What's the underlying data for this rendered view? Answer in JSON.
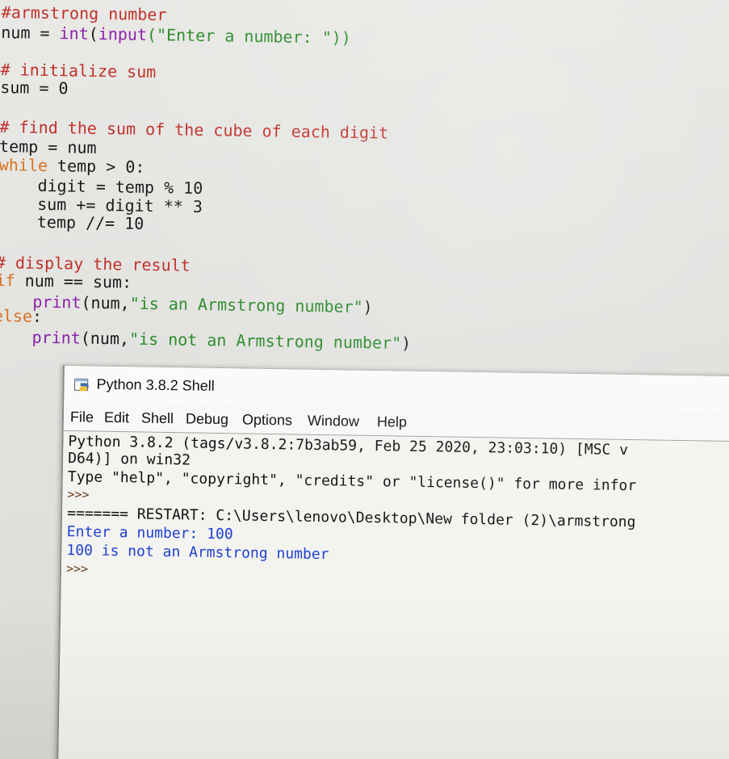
{
  "editor": {
    "lines": [
      {
        "text": "#armstrong number",
        "kind": "comment"
      },
      {
        "parts": [
          "num = ",
          "int",
          "(",
          "input",
          "(\"Enter a number: \"))"
        ]
      },
      {
        "text": "# initialize sum",
        "kind": "comment"
      },
      {
        "text": "sum = 0"
      },
      {
        "text": "# find the sum of the cube of each digit",
        "kind": "comment"
      },
      {
        "text": "temp = num"
      },
      {
        "parts": [
          "while",
          " temp > 0:"
        ]
      },
      {
        "text": "    digit = temp % 10"
      },
      {
        "text": "    sum += digit ** 3"
      },
      {
        "text": "    temp //= 10"
      },
      {
        "text": "# display the result",
        "kind": "comment"
      },
      {
        "parts": [
          "if",
          " num == sum:"
        ]
      },
      {
        "parts": [
          "    print",
          "(num,",
          "\"is an Armstrong number\"",
          ")"
        ]
      },
      {
        "parts": [
          "else",
          ":"
        ]
      },
      {
        "parts": [
          "    print",
          "(num,",
          "\"is not an Armstrong number\"",
          ")"
        ]
      }
    ]
  },
  "shell": {
    "title": "Python 3.8.2 Shell",
    "menu": [
      "File",
      "Edit",
      "Shell",
      "Debug",
      "Options",
      "Window",
      "Help"
    ],
    "output": {
      "banner1": "Python 3.8.2 (tags/v3.8.2:7b3ab59, Feb 25 2020, 23:03:10) [MSC v",
      "banner2": "D64)] on win32",
      "banner3": "Type \"help\", \"copyright\", \"credits\" or \"license()\" for more infor",
      "prompt1": ">>>",
      "restart": "======= RESTART: C:\\Users\\lenovo\\Desktop\\New folder (2)\\armstrong",
      "input_line": "Enter a number: 100",
      "result_line": "100 is not an Armstrong number",
      "prompt2": ">>>"
    }
  },
  "colors": {
    "comment": "#c0302a",
    "keyword": "#d9711f",
    "string": "#2a8a2a",
    "builtin": "#8b22a8",
    "output_blue": "#1f3fd1"
  },
  "icons": {
    "shell_icon": "python-shell-icon"
  }
}
